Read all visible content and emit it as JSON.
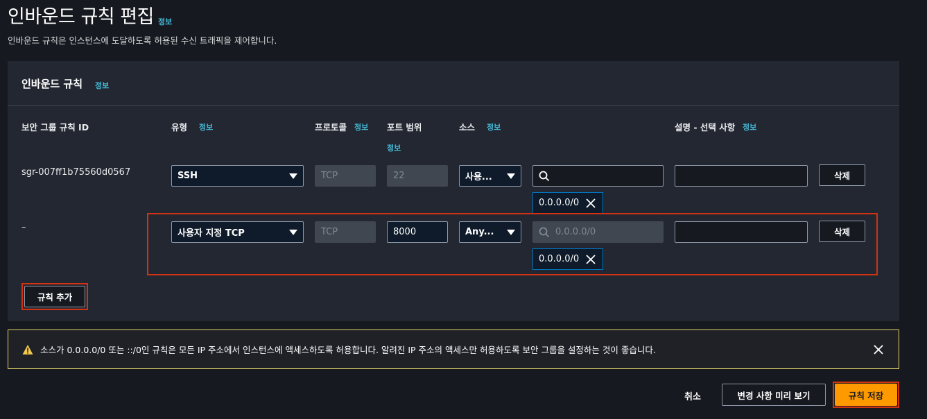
{
  "page": {
    "title": "인바운드 규칙 편집",
    "info": "정보",
    "subtitle": "인바운드 규칙은 인스턴스에 도달하도록 허용된 수신 트래픽을 제어합니다."
  },
  "panel": {
    "title": "인바운드 규칙",
    "info": "정보",
    "columns": {
      "rule_id": "보안 그룹 규칙 ID",
      "type": "유형",
      "protocol": "프로토콜",
      "port_range": "포트 범위",
      "source": "소스",
      "description": "설명 - 선택 사항",
      "info": "정보"
    },
    "rows": [
      {
        "rule_id": "sgr-007ff1b75560d0567",
        "type": "SSH",
        "protocol": "TCP",
        "port": "22",
        "source_type": "사용...",
        "search_value": "",
        "search_placeholder": "",
        "token": "0.0.0.0/0",
        "description": "",
        "delete": "삭제"
      },
      {
        "rule_id": "–",
        "type": "사용자 지정 TCP",
        "protocol": "TCP",
        "port": "8000",
        "source_type": "Any...",
        "search_value": "",
        "search_placeholder": "0.0.0.0/0",
        "token": "0.0.0.0/0",
        "description": "",
        "delete": "삭제"
      }
    ],
    "add_rule": "규칙 추가"
  },
  "warning": {
    "text": "소스가 0.0.0.0/0 또는 ::/0인 규칙은 모든 IP 주소에서 인스턴스에 액세스하도록 허용합니다. 알려진 IP 주소의 액세스만 허용하도록 보안 그룹을 설정하는 것이 좋습니다."
  },
  "footer": {
    "cancel": "취소",
    "preview": "변경 사항 미리 보기",
    "save": "규칙 저장"
  },
  "colors": {
    "accent": "#ff9900",
    "highlight": "#d13212",
    "warning_border": "#e9d46a",
    "link": "#44b9d6"
  }
}
